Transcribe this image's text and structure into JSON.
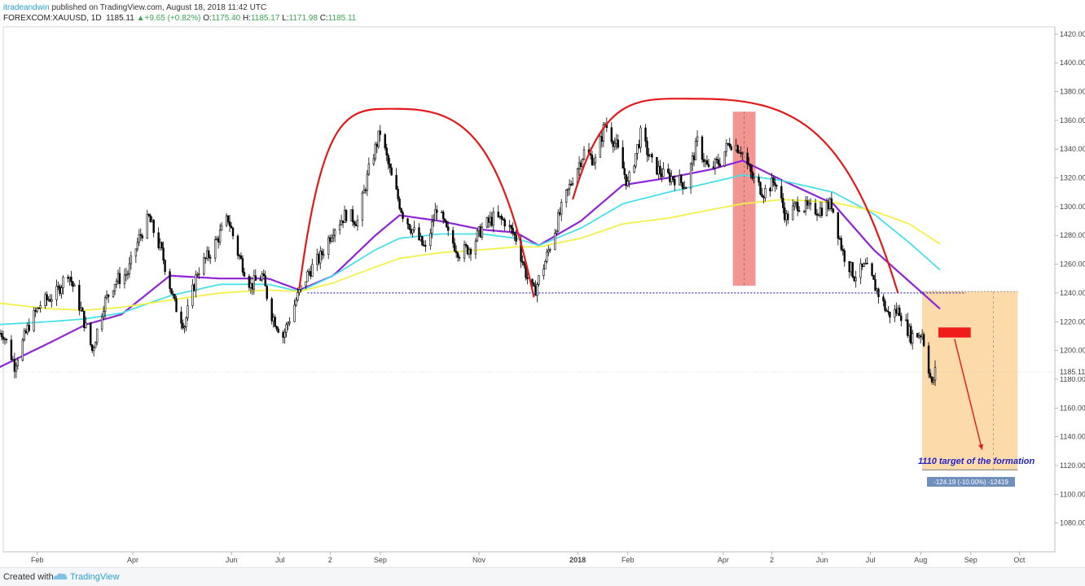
{
  "header": {
    "author": "itradeandwin",
    "published_text": "published on TradingView.com, August 18, 2018 11:42 UTC",
    "symbol": "FOREXCOM:XAUUSD, 1D",
    "last": "1185.11",
    "change": "+9.65 (+0.82%)",
    "o_label": "O:",
    "o_value": "1175.40",
    "h_label": "H:",
    "h_value": "1185.17",
    "l_label": "L:",
    "l_value": "1171.98",
    "c_label": "C:",
    "c_value": "1185.11"
  },
  "footer": {
    "created_with": "Created with",
    "brand": "TradingView"
  },
  "colors": {
    "candle": "#000000",
    "ma_purple": "#8e24d6",
    "ma_cyan": "#48e0e8",
    "ma_yellow": "#f3f04a",
    "pattern": "#e31919",
    "target_box": "#fbd39a",
    "highlight_bar": "#f28b86",
    "neckline": "#2b2aa6"
  },
  "chart_data": {
    "type": "candlestick",
    "title": "",
    "ylim": [
      1060,
      1425
    ],
    "yticks": [
      1080,
      1100,
      1120,
      1140,
      1160,
      1180,
      1200,
      1220,
      1240,
      1260,
      1280,
      1300,
      1320,
      1340,
      1360,
      1380,
      1400,
      1420
    ],
    "ytick_labels": [
      "1080.00",
      "1100.00",
      "1120.00",
      "1140.00",
      "1160.00",
      "1180.00",
      "1200.00",
      "1220.00",
      "1240.00",
      "1260.00",
      "1280.00",
      "1300.00",
      "1320.00",
      "1340.00",
      "1360.00",
      "1380.00",
      "1400.00",
      "1420.00"
    ],
    "xtick_labels": [
      "Feb",
      "Apr",
      "Jun",
      "Jul",
      "2",
      "Sep",
      "Nov",
      "2018",
      "Feb",
      "Apr",
      "2",
      "Jun",
      "Jul",
      "Aug",
      "Sep",
      "Oct"
    ],
    "xtick_dates": [
      "2017-02-01",
      "2017-04-01",
      "2017-06-01",
      "2017-07-01",
      "2017-08-01",
      "2017-09-01",
      "2017-11-01",
      "2018-01-01",
      "2018-02-01",
      "2018-04-01",
      "2018-05-01",
      "2018-06-01",
      "2018-07-01",
      "2018-08-01",
      "2018-09-01",
      "2018-10-01"
    ],
    "last_price_label": "1185.11",
    "price_path": [
      [
        "2017-01-18",
        1212
      ],
      [
        "2017-01-25",
        1190
      ],
      [
        "2017-02-03",
        1218
      ],
      [
        "2017-02-10",
        1232
      ],
      [
        "2017-02-20",
        1240
      ],
      [
        "2017-02-27",
        1255
      ],
      [
        "2017-03-07",
        1228
      ],
      [
        "2017-03-14",
        1200
      ],
      [
        "2017-03-21",
        1232
      ],
      [
        "2017-03-28",
        1248
      ],
      [
        "2017-04-05",
        1254
      ],
      [
        "2017-04-12",
        1278
      ],
      [
        "2017-04-18",
        1292
      ],
      [
        "2017-04-26",
        1268
      ],
      [
        "2017-05-04",
        1232
      ],
      [
        "2017-05-10",
        1218
      ],
      [
        "2017-05-18",
        1255
      ],
      [
        "2017-05-26",
        1268
      ],
      [
        "2017-06-06",
        1292
      ],
      [
        "2017-06-12",
        1268
      ],
      [
        "2017-06-20",
        1245
      ],
      [
        "2017-06-27",
        1252
      ],
      [
        "2017-07-03",
        1225
      ],
      [
        "2017-07-10",
        1210
      ],
      [
        "2017-07-18",
        1235
      ],
      [
        "2017-07-26",
        1255
      ],
      [
        "2017-08-02",
        1265
      ],
      [
        "2017-08-10",
        1285
      ],
      [
        "2017-08-18",
        1295
      ],
      [
        "2017-08-25",
        1290
      ],
      [
        "2017-09-01",
        1325
      ],
      [
        "2017-09-08",
        1352
      ],
      [
        "2017-09-15",
        1320
      ],
      [
        "2017-09-22",
        1295
      ],
      [
        "2017-09-29",
        1282
      ],
      [
        "2017-10-06",
        1270
      ],
      [
        "2017-10-13",
        1300
      ],
      [
        "2017-10-20",
        1280
      ],
      [
        "2017-10-27",
        1268
      ],
      [
        "2017-11-03",
        1272
      ],
      [
        "2017-11-10",
        1285
      ],
      [
        "2017-11-17",
        1292
      ],
      [
        "2017-11-24",
        1290
      ],
      [
        "2017-12-01",
        1278
      ],
      [
        "2017-12-08",
        1250
      ],
      [
        "2017-12-12",
        1240
      ],
      [
        "2017-12-19",
        1262
      ],
      [
        "2017-12-28",
        1295
      ],
      [
        "2018-01-05",
        1320
      ],
      [
        "2018-01-12",
        1338
      ],
      [
        "2018-01-19",
        1332
      ],
      [
        "2018-01-25",
        1358
      ],
      [
        "2018-02-01",
        1342
      ],
      [
        "2018-02-08",
        1315
      ],
      [
        "2018-02-16",
        1350
      ],
      [
        "2018-02-23",
        1330
      ],
      [
        "2018-03-02",
        1322
      ],
      [
        "2018-03-09",
        1320
      ],
      [
        "2018-03-16",
        1315
      ],
      [
        "2018-03-23",
        1345
      ],
      [
        "2018-03-30",
        1325
      ],
      [
        "2018-04-06",
        1332
      ],
      [
        "2018-04-12",
        1345
      ],
      [
        "2018-04-19",
        1340
      ],
      [
        "2018-04-26",
        1320
      ],
      [
        "2018-05-03",
        1310
      ],
      [
        "2018-05-10",
        1318
      ],
      [
        "2018-05-17",
        1292
      ],
      [
        "2018-05-24",
        1302
      ],
      [
        "2018-05-31",
        1298
      ],
      [
        "2018-06-07",
        1298
      ],
      [
        "2018-06-14",
        1302
      ],
      [
        "2018-06-21",
        1268
      ],
      [
        "2018-06-28",
        1252
      ],
      [
        "2018-07-05",
        1258
      ],
      [
        "2018-07-12",
        1242
      ],
      [
        "2018-07-19",
        1225
      ],
      [
        "2018-07-26",
        1228
      ],
      [
        "2018-08-02",
        1210
      ],
      [
        "2018-08-09",
        1212
      ],
      [
        "2018-08-13",
        1188
      ],
      [
        "2018-08-15",
        1175
      ],
      [
        "2018-08-17",
        1185
      ]
    ],
    "series": [
      {
        "values": [
          [
            "2017-01-15",
            1188
          ],
          [
            "2017-02-15",
            1205
          ],
          [
            "2017-03-10",
            1218
          ],
          [
            "2017-04-01",
            1225
          ],
          [
            "2017-05-01",
            1252
          ],
          [
            "2017-06-01",
            1250
          ],
          [
            "2017-07-01",
            1250
          ],
          [
            "2017-07-20",
            1242
          ],
          [
            "2017-08-10",
            1252
          ],
          [
            "2017-09-05",
            1280
          ],
          [
            "2017-09-20",
            1294
          ],
          [
            "2017-10-15",
            1290
          ],
          [
            "2017-11-10",
            1284
          ],
          [
            "2017-12-01",
            1282
          ],
          [
            "2017-12-15",
            1273
          ],
          [
            "2018-01-10",
            1290
          ],
          [
            "2018-02-05",
            1315
          ],
          [
            "2018-03-05",
            1320
          ],
          [
            "2018-04-01",
            1326
          ],
          [
            "2018-04-20",
            1332
          ],
          [
            "2018-05-15",
            1318
          ],
          [
            "2018-06-15",
            1302
          ],
          [
            "2018-07-10",
            1270
          ],
          [
            "2018-08-01",
            1248
          ],
          [
            "2018-08-20",
            1229
          ]
        ]
      },
      {
        "values": [
          [
            "2017-01-15",
            1218
          ],
          [
            "2017-02-15",
            1220
          ],
          [
            "2017-03-10",
            1222
          ],
          [
            "2017-04-01",
            1226
          ],
          [
            "2017-05-01",
            1238
          ],
          [
            "2017-06-01",
            1246
          ],
          [
            "2017-07-01",
            1246
          ],
          [
            "2017-07-20",
            1241
          ],
          [
            "2017-08-10",
            1252
          ],
          [
            "2017-09-05",
            1270
          ],
          [
            "2017-09-20",
            1278
          ],
          [
            "2017-10-15",
            1281
          ],
          [
            "2017-11-10",
            1281
          ],
          [
            "2017-12-01",
            1278
          ],
          [
            "2017-12-15",
            1273
          ],
          [
            "2018-01-10",
            1285
          ],
          [
            "2018-02-05",
            1302
          ],
          [
            "2018-03-05",
            1310
          ],
          [
            "2018-04-01",
            1317
          ],
          [
            "2018-04-20",
            1322
          ],
          [
            "2018-05-15",
            1318
          ],
          [
            "2018-06-15",
            1310
          ],
          [
            "2018-07-10",
            1295
          ],
          [
            "2018-08-01",
            1275
          ],
          [
            "2018-08-20",
            1256
          ]
        ]
      },
      {
        "values": [
          [
            "2017-01-15",
            1233
          ],
          [
            "2017-02-15",
            1229
          ],
          [
            "2017-03-10",
            1228
          ],
          [
            "2017-04-01",
            1230
          ],
          [
            "2017-05-01",
            1235
          ],
          [
            "2017-06-01",
            1240
          ],
          [
            "2017-07-01",
            1242
          ],
          [
            "2017-07-20",
            1241
          ],
          [
            "2017-08-10",
            1247
          ],
          [
            "2017-09-05",
            1258
          ],
          [
            "2017-09-20",
            1264
          ],
          [
            "2017-10-15",
            1268
          ],
          [
            "2017-11-10",
            1270
          ],
          [
            "2017-12-01",
            1272
          ],
          [
            "2017-12-15",
            1272
          ],
          [
            "2018-01-10",
            1278
          ],
          [
            "2018-02-05",
            1288
          ],
          [
            "2018-03-05",
            1292
          ],
          [
            "2018-04-01",
            1298
          ],
          [
            "2018-04-20",
            1302
          ],
          [
            "2018-05-15",
            1305
          ],
          [
            "2018-06-15",
            1303
          ],
          [
            "2018-07-10",
            1297
          ],
          [
            "2018-08-01",
            1288
          ],
          [
            "2018-08-20",
            1274
          ]
        ]
      }
    ],
    "annotations": {
      "target_text": "1110 target of the formation",
      "measure_label": "-124.19 (-10.00%) -12419",
      "neckline_price": 1240,
      "target_box": {
        "from_date": "2018-08-09",
        "to_date": "2018-10-07",
        "top": 1241,
        "bottom": 1117
      },
      "highlight_bar": {
        "from_date": "2018-04-14",
        "to_date": "2018-04-28",
        "top": 1366,
        "bottom": 1245
      },
      "red_marker": {
        "from_date": "2018-08-19",
        "to_date": "2018-09-08",
        "top": 1216,
        "bottom": 1209
      },
      "arrow": {
        "from": [
          "2018-08-29",
          1208
        ],
        "to": [
          "2018-09-15",
          1131
        ]
      },
      "shoulders": [
        {
          "start": [
            "2017-07-20",
            1243
          ],
          "peak": [
            "2017-09-20",
            1368
          ],
          "end": [
            "2017-12-12",
            1237
          ]
        },
        {
          "start": [
            "2018-01-05",
            1305
          ],
          "peak": [
            "2018-03-25",
            1375
          ],
          "end": [
            "2018-07-25",
            1240
          ]
        }
      ],
      "neckline_from_date": "2017-07-25",
      "neckline_to_date": "2018-09-05"
    }
  }
}
